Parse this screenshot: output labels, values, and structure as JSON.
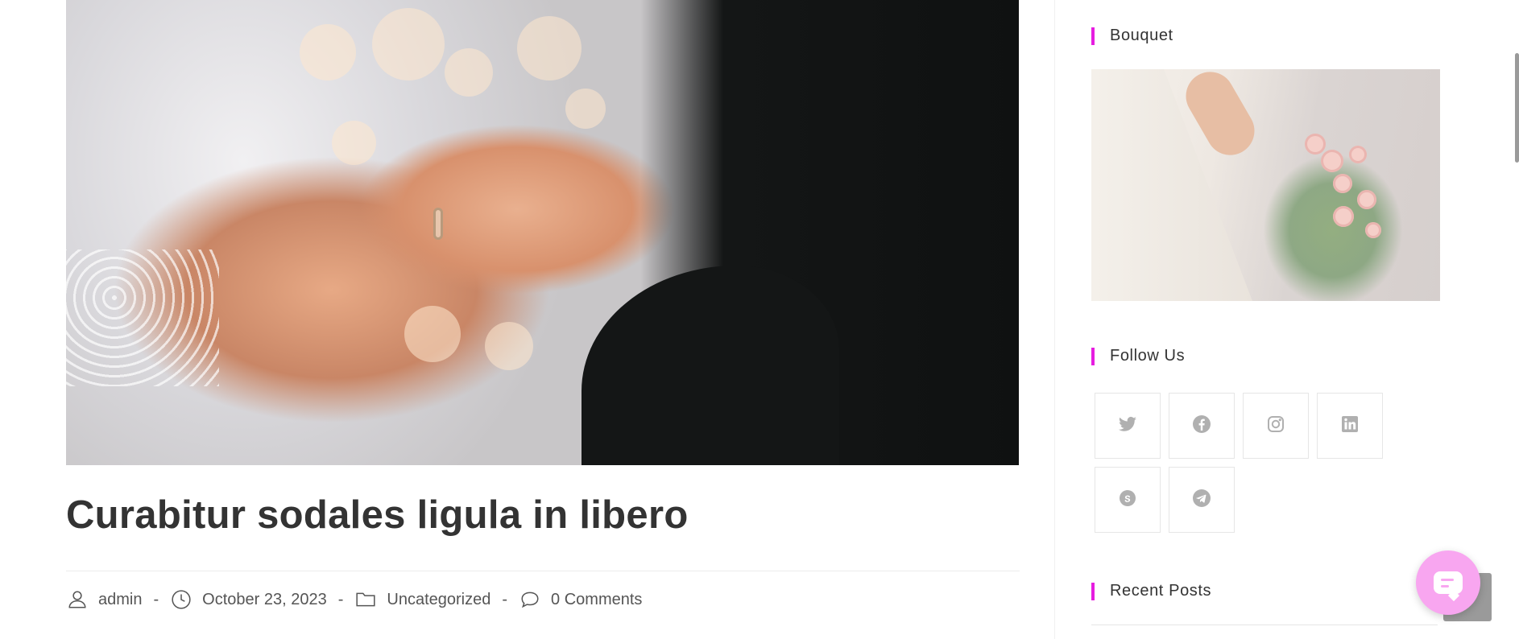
{
  "post": {
    "title": "Curabitur sodales ligula in libero",
    "meta": {
      "author": "admin",
      "date": "October 23, 2023",
      "category": "Uncategorized",
      "comments": "0 Comments",
      "separator": "-"
    }
  },
  "sidebar": {
    "bouquet_title": "Bouquet",
    "follow_title": "Follow Us",
    "recent_title": "Recent Posts",
    "social": [
      "twitter-icon",
      "facebook-icon",
      "instagram-icon",
      "linkedin-icon",
      "skype-icon",
      "telegram-icon"
    ]
  },
  "colors": {
    "accent": "#e61de0",
    "chat_button": "#f8a6f0",
    "text": "#333333",
    "social_icon": "#b0b0b0"
  }
}
